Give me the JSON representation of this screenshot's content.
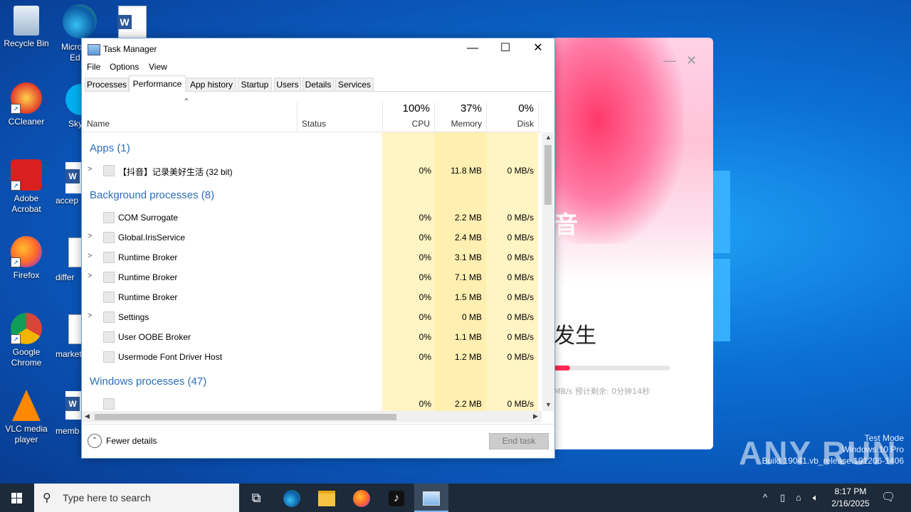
{
  "desktop": {
    "icons": [
      {
        "label": "Recycle Bin"
      },
      {
        "label": "CCleaner"
      },
      {
        "label": "Adobe Acrobat"
      },
      {
        "label": "Firefox"
      },
      {
        "label": "Google Chrome"
      },
      {
        "label": "VLC media player"
      }
    ],
    "partial_labels": [
      "Micro",
      "Ed",
      "Sky",
      "accep",
      "differ",
      "market",
      "memb"
    ]
  },
  "bg_app": {
    "heading": "发生",
    "big_char": "音",
    "progress_percent": 14,
    "speed_text": "MB/s 预计剩余: 0分钟14秒",
    "accent": "#fe2c55"
  },
  "watermark": {
    "brand": "ANY RUN",
    "line1": "Test Mode",
    "line2": "Windows 10 Pro",
    "line3": "Build 19041.vb_release.191206-1406"
  },
  "task_manager": {
    "title": "Task Manager",
    "menu": [
      "File",
      "Options",
      "View"
    ],
    "tabs": [
      "Processes",
      "Performance",
      "App history",
      "Startup",
      "Users",
      "Details",
      "Services"
    ],
    "active_tab": "Performance",
    "columns": {
      "name": "Name",
      "status": "Status",
      "cpu_pct": "100%",
      "cpu": "CPU",
      "mem_pct": "37%",
      "memory": "Memory",
      "disk_pct": "0%",
      "disk": "Disk"
    },
    "groups": {
      "apps": "Apps (1)",
      "background": "Background processes (8)",
      "windows": "Windows processes (47)"
    },
    "apps": [
      {
        "name": "【抖音】记录美好生活 (32 bit)",
        "cpu": "0%",
        "memory": "11.8 MB",
        "disk": "0 MB/s",
        "expandable": true
      }
    ],
    "background": [
      {
        "name": "COM Surrogate",
        "cpu": "0%",
        "memory": "2.2 MB",
        "disk": "0 MB/s",
        "expandable": false
      },
      {
        "name": "Global.IrisService",
        "cpu": "0%",
        "memory": "2.4 MB",
        "disk": "0 MB/s",
        "expandable": true
      },
      {
        "name": "Runtime Broker",
        "cpu": "0%",
        "memory": "3.1 MB",
        "disk": "0 MB/s",
        "expandable": true
      },
      {
        "name": "Runtime Broker",
        "cpu": "0%",
        "memory": "7.1 MB",
        "disk": "0 MB/s",
        "expandable": true
      },
      {
        "name": "Runtime Broker",
        "cpu": "0%",
        "memory": "1.5 MB",
        "disk": "0 MB/s",
        "expandable": false
      },
      {
        "name": "Settings",
        "cpu": "0%",
        "memory": "0 MB",
        "disk": "0 MB/s",
        "expandable": true
      },
      {
        "name": "User OOBE Broker",
        "cpu": "0%",
        "memory": "1.1 MB",
        "disk": "0 MB/s",
        "expandable": false
      },
      {
        "name": "Usermode Font Driver Host",
        "cpu": "0%",
        "memory": "1.2 MB",
        "disk": "0 MB/s",
        "expandable": false
      }
    ],
    "windows": [
      {
        "name": "",
        "cpu": "0%",
        "memory": "2.2 MB",
        "disk": "0 MB/s",
        "expandable": false
      }
    ],
    "fewer_details": "Fewer details",
    "end_task": "End task"
  },
  "taskbar": {
    "search_placeholder": "Type here to search",
    "time": "8:17 PM",
    "date": "2/16/2025"
  }
}
